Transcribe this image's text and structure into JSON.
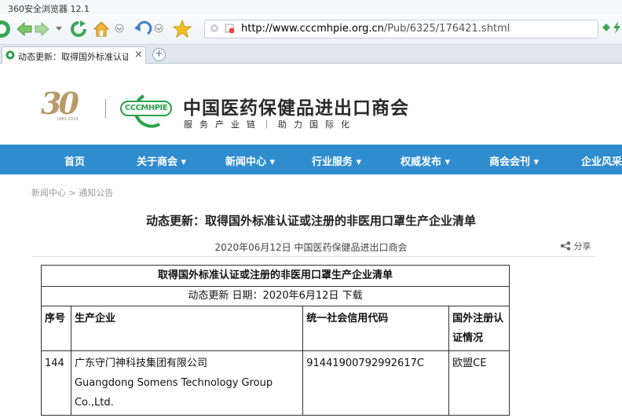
{
  "browser": {
    "title": "360安全浏览器 12.1",
    "url_domain": "http://www.cccmhpie.org.cn",
    "url_path": "/Pub/6325/176421.shtml",
    "tab_label": "动态更新：取得国外标准认证或注",
    "tab_close": "×",
    "new_tab": "+"
  },
  "header": {
    "logo_number": "30",
    "logo_years": "1989-2019",
    "cccm_logo_text": "CCCMHPIE",
    "org_name": "中国医药保健品进出口商会",
    "slogan": "服务产业链｜助力国际化"
  },
  "menu": {
    "items": [
      "首页",
      "关于商会 ▾",
      "新闻中心 ▾",
      "行业服务 ▾",
      "权威发布 ▾",
      "商会会刊 ▾",
      "企业风采"
    ]
  },
  "breadcrumb": "新闻中心 > 通知公告",
  "article": {
    "title": "动态更新：取得国外标准认证或注册的非医用口罩生产企业清单",
    "meta": "2020年06月12日   中国医药保健品进出口商会",
    "share_label": "分享"
  },
  "table": {
    "title": "取得国外标准认证或注册的非医用口罩生产企业清单",
    "subtitle": "动态更新 日期：2020年6月12日 下载",
    "headers": [
      "序号",
      "生产企业",
      "统一社会信用代码",
      "国外注册认证情况"
    ],
    "rows": [
      {
        "no": "144",
        "company_cn": "广东守门神科技集团有限公司",
        "company_en": "Guangdong Somens Technology Group Co.,Ltd.",
        "credit_code": "91441900792992617C",
        "cert": "欧盟CE"
      }
    ]
  },
  "colors": {
    "menu_bg": "#2f8ccf",
    "brand_green": "#2aa24a",
    "logo_gold": "#b89a68"
  }
}
